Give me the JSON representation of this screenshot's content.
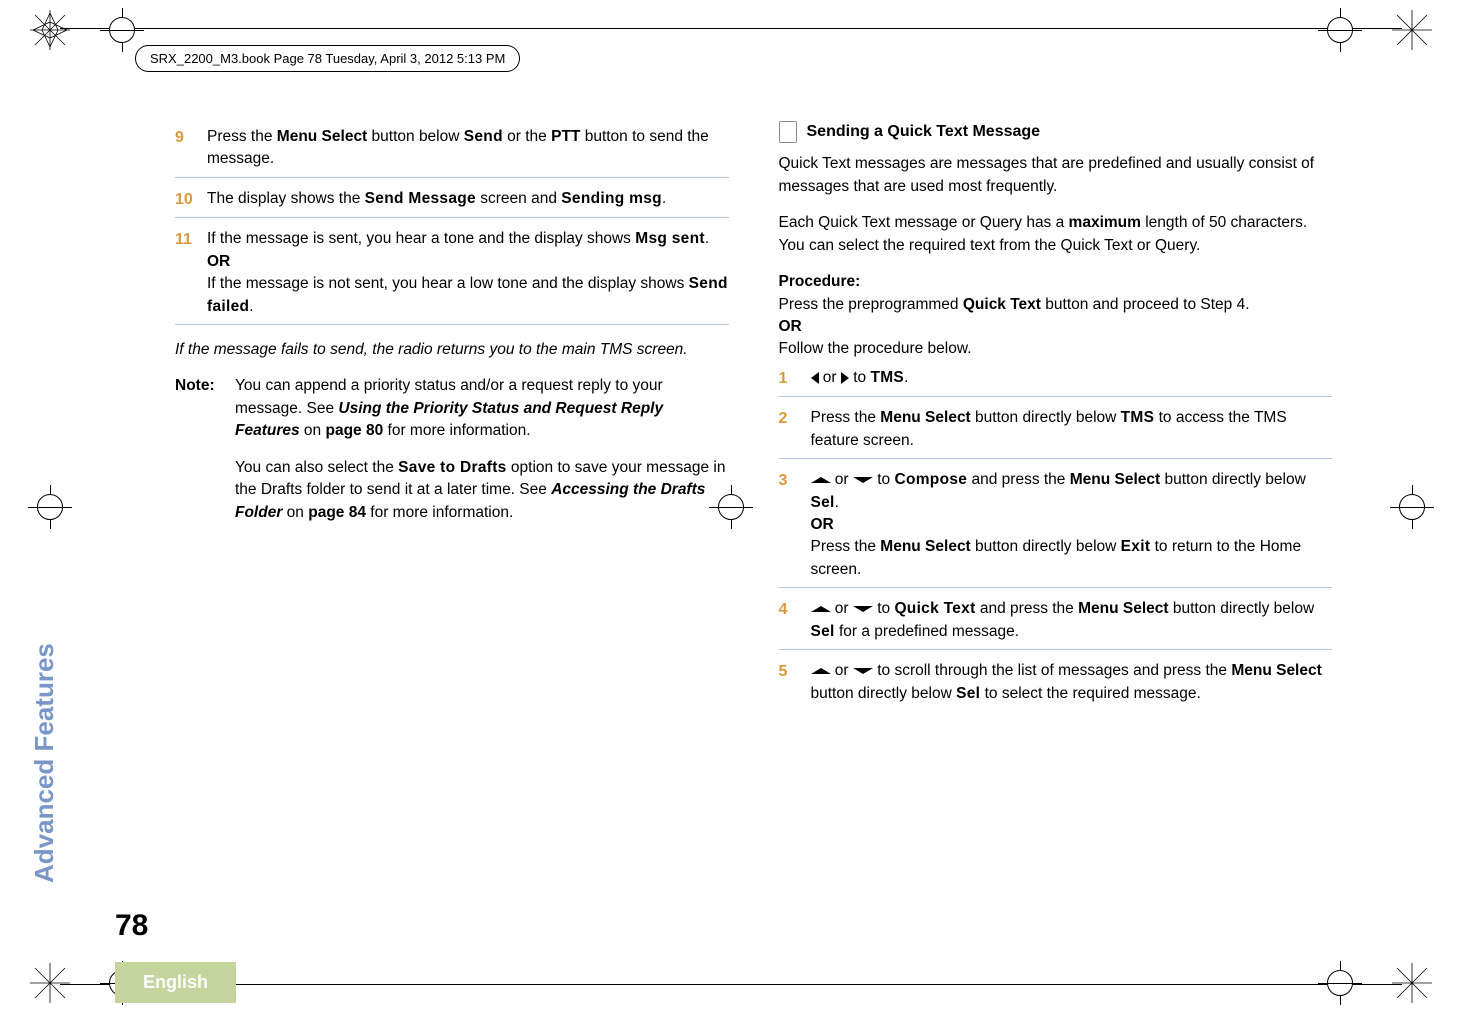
{
  "header": "SRX_2200_M3.book  Page 78  Tuesday, April 3, 2012  5:13 PM",
  "side_tab": "Advanced Features",
  "page_number": "78",
  "language": "English",
  "left_col": {
    "step9": {
      "num": "9",
      "t1": "Press the ",
      "b1": "Menu Select",
      "t2": " button below ",
      "u1": "Send",
      "t3": " or the ",
      "b2": "PTT",
      "t4": " button to send the message."
    },
    "step10": {
      "num": "10",
      "t1": "The display shows the ",
      "u1": "Send Message",
      "t2": " screen and ",
      "u2": "Sending msg",
      "t3": "."
    },
    "step11": {
      "num": "11",
      "t1": "If the message is sent, you hear a tone and the display shows ",
      "u1": "Msg sent",
      "t2": ".",
      "or": "OR",
      "t3": "If the message is not sent, you hear a low tone and the display shows ",
      "u2": "Send failed",
      "t4": "."
    },
    "fail_para": "If the message fails to send, the radio returns you to the main TMS screen.",
    "note_label": "Note:",
    "note_p1_a": "You can append a priority status and/or a request reply to your message. See ",
    "note_p1_b": "Using the Priority Status and Request Reply Features",
    "note_p1_c": " on ",
    "note_p1_d": "page 80",
    "note_p1_e": " for more information.",
    "note_p2_a": "You can also select the ",
    "note_p2_u": "Save to Drafts",
    "note_p2_b": " option to save your message in the Drafts folder to send it at a later time. See ",
    "note_p2_c": "Accessing the Drafts Folder",
    "note_p2_d": " on ",
    "note_p2_e": "page 84",
    "note_p2_f": " for more information."
  },
  "right_col": {
    "section_title": "Sending a Quick Text Message",
    "intro1": "Quick Text messages are messages that are predefined and usually consist of messages that are used most frequently.",
    "intro2_a": "Each Quick Text message or Query has a ",
    "intro2_b": "maximum",
    "intro2_c": " length of 50 characters. You can select the required text from the Quick Text or Query.",
    "proc_label": "Procedure:",
    "proc_1a": "Press the preprogrammed ",
    "proc_1b": "Quick Text",
    "proc_1c": " button and proceed to Step 4.",
    "proc_or": "OR",
    "proc_2": "Follow the procedure below.",
    "s1": {
      "num": "1",
      "t1": " or ",
      "t2": " to ",
      "u1": "TMS",
      "t3": "."
    },
    "s2": {
      "num": "2",
      "t1": "Press the ",
      "b1": "Menu Select",
      "t2": " button directly below ",
      "u1": "TMS",
      "t3": " to access the TMS feature screen."
    },
    "s3": {
      "num": "3",
      "t1": " or ",
      "t2": " to ",
      "u1": "Compose",
      "t3": " and press the ",
      "b1": "Menu Select",
      "t4": " button directly below ",
      "u2": "Sel",
      "t5": ".",
      "or": "OR",
      "t6": "Press the ",
      "b2": "Menu Select",
      "t7": " button directly below ",
      "u3": "Exit",
      "t8": " to return to the Home screen."
    },
    "s4": {
      "num": "4",
      "t1": " or ",
      "t2": " to ",
      "u1": "Quick Text",
      "t3": " and press the ",
      "b1": "Menu Select",
      "t4": " button directly below ",
      "u2": "Sel",
      "t5": " for a predefined message."
    },
    "s5": {
      "num": "5",
      "t1": " or ",
      "t2": " to scroll through the list of messages and press the ",
      "b1": "Menu Select",
      "t3": " button directly below ",
      "u1": "Sel",
      "t4": " to select the required message."
    }
  }
}
